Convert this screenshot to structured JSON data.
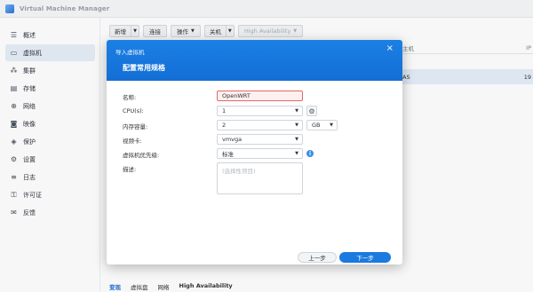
{
  "app": {
    "title": "Virtual Machine Manager"
  },
  "sidebar": {
    "items": [
      {
        "label": "概述",
        "icon": "list-icon"
      },
      {
        "label": "虚拟机",
        "icon": "monitor-icon",
        "active": true
      },
      {
        "label": "集群",
        "icon": "cluster-icon"
      },
      {
        "label": "存储",
        "icon": "storage-icon"
      },
      {
        "label": "网络",
        "icon": "network-icon"
      },
      {
        "label": "映像",
        "icon": "image-icon"
      },
      {
        "label": "保护",
        "icon": "shield-icon"
      },
      {
        "label": "设置",
        "icon": "gear-icon"
      },
      {
        "label": "日志",
        "icon": "log-icon"
      },
      {
        "label": "许可证",
        "icon": "key-icon"
      },
      {
        "label": "反馈",
        "icon": "feedback-icon"
      }
    ]
  },
  "toolbar": {
    "create": "新增",
    "connect": "连接",
    "action": "操作",
    "shutdown": "关机",
    "ha": "High Availability"
  },
  "grid": {
    "header_partial": "主机",
    "header_partial_2": "IP",
    "row_partial": "AS",
    "row_partial_2": "19"
  },
  "bottom_tabs": [
    "变现",
    "虚拟盘",
    "网络",
    "High Availability"
  ],
  "dialog": {
    "window_title": "导入虚拟机",
    "title": "配置常用规格",
    "fields": {
      "name_label": "名称:",
      "name_value": "OpenWRT",
      "cpu_label": "CPU(s):",
      "cpu_value": "1",
      "memory_label": "内存容量:",
      "memory_value": "2",
      "memory_unit": "GB",
      "video_label": "视频卡:",
      "video_value": "vmvga",
      "priority_label": "虚拟机优先级:",
      "priority_value": "标准",
      "description_label": "描述:",
      "description_placeholder": "(选择性项目)"
    },
    "buttons": {
      "prev": "上一步",
      "next": "下一步"
    }
  },
  "colors": {
    "accent": "#1b7ae0",
    "error_border": "#e26a66"
  }
}
